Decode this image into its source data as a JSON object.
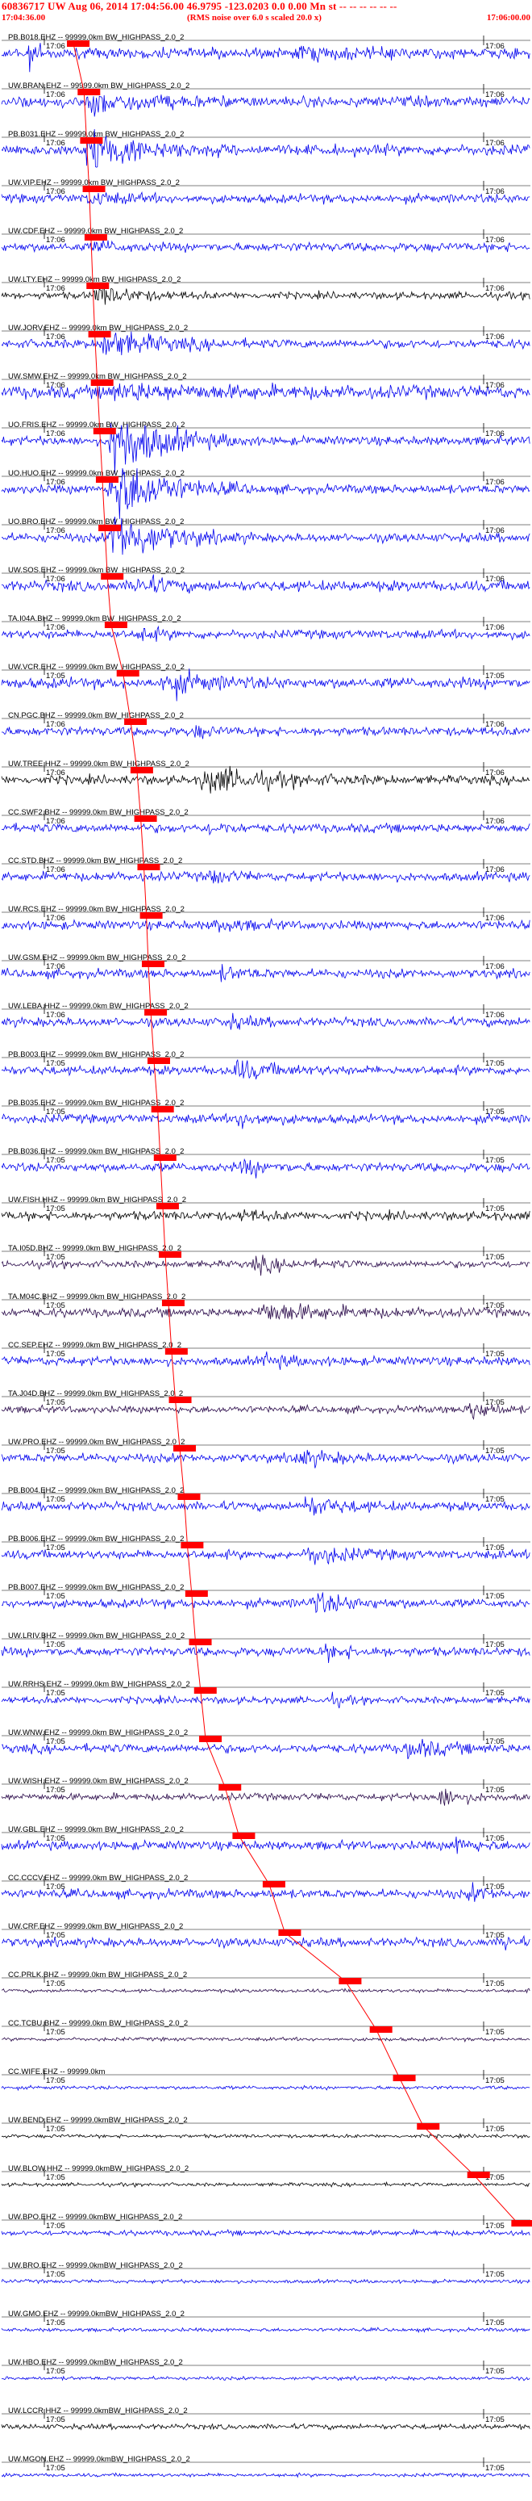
{
  "header": {
    "title": "60836717 UW Aug 06, 2014 17:04:56.00   46.9795 -123.0203  0.0 0.00 Mn st -- -- -- -- -- --",
    "start_time": "17:04:36.00",
    "noise_note": "(RMS noise over 6.0 s scaled 20.0 x)",
    "end_time": "17:06:00.00"
  },
  "colors": {
    "trace_blue": "#0000ee",
    "trace_black": "#000000",
    "trace_purple": "#2a0a4a",
    "marker": "#ff0000",
    "tick": "#000000"
  },
  "chart_data": {
    "type": "seismogram",
    "x_range": [
      "17:04:36.00",
      "17:06:00.00"
    ],
    "pick_times_s": [
      11.4,
      13.1,
      13.5,
      13.9,
      14.2,
      14.5,
      14.8,
      15.2,
      15.6,
      16.0,
      16.4,
      16.8,
      17.4,
      19.3,
      20.5,
      21.5,
      22.1,
      22.6,
      23.0,
      23.3,
      23.7,
      24.2,
      24.8,
      25.2,
      25.6,
      26.0,
      26.5,
      27.0,
      27.6,
      28.3,
      29.0,
      29.5,
      30.2,
      30.8,
      31.6,
      32.4,
      35.5,
      37.7,
      42.5,
      45.0,
      54.6,
      59.5,
      63.2,
      67.0,
      75.0,
      82.0
    ],
    "traces": [
      {
        "label": "PB.B018.EHZ -- 99999.0km BW_HIGHPASS_2.0_2",
        "tick_label": "17:06",
        "color": "blue",
        "amp": 6,
        "events": [
          [
            0.05,
            0.1,
            14
          ],
          [
            0.55,
            0.9,
            4
          ]
        ]
      },
      {
        "label": "UW.BRAN.EHZ -- 99999.0km BW_HIGHPASS_2.0_2",
        "tick_label": "17:06",
        "color": "blue",
        "amp": 6,
        "events": [
          [
            0.16,
            0.45,
            12
          ]
        ]
      },
      {
        "label": "PB.B031.EHZ -- 99999.0km BW_HIGHPASS_2.0_2",
        "tick_label": "17:06",
        "color": "blue",
        "amp": 6,
        "events": [
          [
            0.15,
            0.45,
            22
          ]
        ]
      },
      {
        "label": "UW.VIP.EHZ -- 99999.0km BW_HIGHPASS_2.0_2",
        "tick_label": "17:06",
        "color": "blue",
        "amp": 5,
        "events": [
          [
            0.16,
            0.35,
            6
          ]
        ]
      },
      {
        "label": "UW.CDF.EHZ -- 99999.0km BW_HIGHPASS_2.0_2",
        "tick_label": "17:06",
        "color": "blue",
        "amp": 5,
        "events": [
          [
            0.17,
            0.3,
            6
          ]
        ]
      },
      {
        "label": "UW.LTY.EHZ -- 99999.0km BW_HIGHPASS_2.0_2",
        "tick_label": "17:06",
        "color": "black",
        "amp": 4,
        "events": [
          [
            0.17,
            0.4,
            10
          ]
        ]
      },
      {
        "label": "UW.JORV.EHZ -- 99999.0km BW_HIGHPASS_2.0_2",
        "tick_label": "17:06",
        "color": "blue",
        "amp": 5,
        "events": [
          [
            0.18,
            0.5,
            14
          ]
        ]
      },
      {
        "label": "UW.SMW.EHZ -- 99999.0km BW_HIGHPASS_2.0_2",
        "tick_label": "17:06",
        "color": "blue",
        "amp": 7,
        "events": [
          [
            0.18,
            0.9,
            6
          ]
        ]
      },
      {
        "label": "UO.FRIS.EHZ -- 99999.0km BW_HIGHPASS_2.0_2",
        "tick_label": "17:06",
        "color": "blue",
        "amp": 5,
        "events": [
          [
            0.2,
            0.48,
            40
          ]
        ]
      },
      {
        "label": "UO.HUO.EHZ -- 99999.0km BW_HIGHPASS_2.0_2",
        "tick_label": "17:06",
        "color": "blue",
        "amp": 5,
        "events": [
          [
            0.2,
            0.48,
            40
          ]
        ]
      },
      {
        "label": "UO.BRO.EHZ -- 99999.0km BW_HIGHPASS_2.0_2",
        "tick_label": "17:06",
        "color": "blue",
        "amp": 5,
        "events": [
          [
            0.2,
            0.48,
            30
          ]
        ]
      },
      {
        "label": "UW.SOS.EHZ -- 99999.0km BW_HIGHPASS_2.0_2",
        "tick_label": "17:06",
        "color": "blue",
        "amp": 6,
        "events": [
          [
            0.25,
            0.4,
            10
          ]
        ]
      },
      {
        "label": "TA.I04A.BHZ -- 99999.0km BW_HIGHPASS_2.0_2",
        "tick_label": "17:06",
        "color": "blue",
        "amp": 5,
        "events": [
          [
            0.26,
            0.35,
            8
          ]
        ]
      },
      {
        "label": "UW.VCR.EHZ -- 99999.0km BW_HIGHPASS_2.0_2",
        "tick_label": "17:05",
        "color": "blue",
        "amp": 6,
        "events": [
          [
            0.3,
            0.55,
            12
          ]
        ]
      },
      {
        "label": "CN.PGC.BHZ -- 99999.0km BW_HIGHPASS_2.0_2",
        "tick_label": "17:06",
        "color": "blue",
        "amp": 5,
        "events": [
          [
            0.36,
            0.45,
            6
          ]
        ]
      },
      {
        "label": "UW.TREE.HHZ -- 99999.0km BW_HIGHPASS_2.0_2",
        "tick_label": "17:06",
        "color": "black",
        "amp": 5,
        "events": [
          [
            0.37,
            0.75,
            14
          ]
        ]
      },
      {
        "label": "CC.SWF2.BHZ -- 99999.0km BW_HIGHPASS_2.0_2",
        "tick_label": "17:06",
        "color": "blue",
        "amp": 5,
        "events": [
          [
            0.39,
            0.5,
            6
          ]
        ]
      },
      {
        "label": "CC.STD.BHZ -- 99999.0km BW_HIGHPASS_2.0_2",
        "tick_label": "17:06",
        "color": "blue",
        "amp": 5,
        "events": [
          [
            0.39,
            0.5,
            8
          ]
        ]
      },
      {
        "label": "UW.RCS.EHZ -- 99999.0km BW_HIGHPASS_2.0_2",
        "tick_label": "17:06",
        "color": "blue",
        "amp": 5,
        "events": [
          [
            0.4,
            0.55,
            6
          ]
        ]
      },
      {
        "label": "UW.GSM.EHZ -- 99999.0km BW_HIGHPASS_2.0_2",
        "tick_label": "17:06",
        "color": "blue",
        "amp": 5,
        "events": [
          [
            0.41,
            0.55,
            6
          ]
        ]
      },
      {
        "label": "UW.LEBA.HHZ -- 99999.0km BW_HIGHPASS_2.0_2",
        "tick_label": "17:06",
        "color": "blue",
        "amp": 5,
        "events": [
          [
            0.42,
            0.55,
            6
          ]
        ]
      },
      {
        "label": "PB.B003.EHZ -- 99999.0km BW_HIGHPASS_2.0_2",
        "tick_label": "17:05",
        "color": "blue",
        "amp": 5,
        "events": [
          [
            0.43,
            0.65,
            10
          ]
        ]
      },
      {
        "label": "PB.B035.EHZ -- 99999.0km BW_HIGHPASS_2.0_2",
        "tick_label": "17:05",
        "color": "blue",
        "amp": 5,
        "events": [
          [
            0.44,
            0.6,
            8
          ]
        ]
      },
      {
        "label": "PB.B036.EHZ -- 99999.0km BW_HIGHPASS_2.0_2",
        "tick_label": "17:05",
        "color": "blue",
        "amp": 5,
        "events": [
          [
            0.45,
            0.6,
            8
          ]
        ]
      },
      {
        "label": "UW.FISH.HHZ -- 99999.0km BW_HIGHPASS_2.0_2",
        "tick_label": "17:05",
        "color": "black",
        "amp": 5,
        "events": [
          [
            0.45,
            0.55,
            6
          ]
        ]
      },
      {
        "label": "TA.I05D.BHZ -- 99999.0km BW_HIGHPASS_2.0_2",
        "tick_label": "17:05",
        "color": "purple",
        "amp": 4,
        "events": [
          [
            0.47,
            0.7,
            7
          ]
        ]
      },
      {
        "label": "TA.M04C.BHZ -- 99999.0km BW_HIGHPASS_2.0_2",
        "tick_label": "17:05",
        "color": "purple",
        "amp": 5,
        "events": [
          [
            0.48,
            0.85,
            10
          ]
        ]
      },
      {
        "label": "CC.SEP.EHZ -- 99999.0km BW_HIGHPASS_2.0_2",
        "tick_label": "17:05",
        "color": "blue",
        "amp": 5,
        "events": [
          [
            0.49,
            0.65,
            6
          ]
        ]
      },
      {
        "label": "TA.J04D.BHZ -- 99999.0km BW_HIGHPASS_2.0_2",
        "tick_label": "17:05",
        "color": "purple",
        "amp": 4,
        "events": [
          [
            0.88,
            1.0,
            14
          ]
        ]
      },
      {
        "label": "UW.PRO.EHZ -- 99999.0km BW_HIGHPASS_2.0_2",
        "tick_label": "17:05",
        "color": "blue",
        "amp": 5,
        "events": [
          [
            0.55,
            0.75,
            8
          ]
        ]
      },
      {
        "label": "PB.B004.EHZ -- 99999.0km BW_HIGHPASS_2.0_2",
        "tick_label": "17:05",
        "color": "blue",
        "amp": 5,
        "events": [
          [
            0.56,
            0.8,
            10
          ]
        ]
      },
      {
        "label": "PB.B006.EHZ -- 99999.0km BW_HIGHPASS_2.0_2",
        "tick_label": "17:05",
        "color": "blue",
        "amp": 5,
        "events": [
          [
            0.57,
            0.8,
            10
          ]
        ]
      },
      {
        "label": "PB.B007.EHZ -- 99999.0km BW_HIGHPASS_2.0_2",
        "tick_label": "17:05",
        "color": "blue",
        "amp": 5,
        "events": [
          [
            0.58,
            0.8,
            10
          ]
        ]
      },
      {
        "label": "UW.LRIV.BHZ -- 99999.0km BW_HIGHPASS_2.0_2",
        "tick_label": "17:05",
        "color": "blue",
        "amp": 5,
        "events": [
          [
            0.6,
            0.8,
            6
          ]
        ]
      },
      {
        "label": "UW.RRHS.EHZ -- 99999.0km BW_HIGHPASS_2.0_2",
        "tick_label": "17:05",
        "color": "blue",
        "amp": 4,
        "events": [
          [
            0.62,
            0.7,
            5
          ]
        ]
      },
      {
        "label": "UW.WNW.EHZ -- 99999.0km BW_HIGHPASS_2.0_2",
        "tick_label": "17:05",
        "color": "blue",
        "amp": 5,
        "events": [
          [
            0.76,
            0.95,
            10
          ]
        ]
      },
      {
        "label": "UW.WISH.EHZ -- 99999.0km BW_HIGHPASS_2.0_2",
        "tick_label": "17:05",
        "color": "purple",
        "amp": 4,
        "events": [
          [
            0.82,
            0.95,
            12
          ]
        ]
      },
      {
        "label": "UW.GBL.EHZ -- 99999.0km BW_HIGHPASS_2.0_2",
        "tick_label": "17:05",
        "color": "blue",
        "amp": 5,
        "events": [
          [
            0.85,
            0.97,
            8
          ]
        ]
      },
      {
        "label": "CC.CCCV.EHZ -- 99999.0km BW_HIGHPASS_2.0_2",
        "tick_label": "17:05",
        "color": "blue",
        "amp": 5,
        "events": [
          [
            0.88,
            1.0,
            8
          ]
        ]
      },
      {
        "label": "UW.CRF.EHZ -- 99999.0km BW_HIGHPASS_2.0_2",
        "tick_label": "17:05",
        "color": "blue",
        "amp": 5,
        "events": [
          [
            0.95,
            1.0,
            10
          ]
        ]
      },
      {
        "label": "CC.PRLK.BHZ -- 99999.0km BW_HIGHPASS_2.0_2",
        "tick_label": "17:05",
        "color": "purple",
        "amp": 2,
        "events": []
      },
      {
        "label": "CC.TCBU.BHZ -- 99999.0km BW_HIGHPASS_2.0_2",
        "tick_label": "17:05",
        "color": "purple",
        "amp": 2,
        "events": []
      },
      {
        "label": "CC.WIFE.EHZ -- 99999.0km",
        "tick_label": "17:05",
        "color": "blue",
        "amp": 2,
        "events": []
      },
      {
        "label": "UW.BEND.EHZ -- 99999.0kmBW_HIGHPASS_2.0_2",
        "tick_label": "17:05",
        "color": "black",
        "amp": 2,
        "events": []
      },
      {
        "label": "UW.BLOW.HHZ -- 99999.0kmBW_HIGHPASS_2.0_2",
        "tick_label": "17:05",
        "color": "black",
        "amp": 2,
        "events": []
      },
      {
        "label": "UW.BPO.EHZ -- 99999.0kmBW_HIGHPASS_2.0_2",
        "tick_label": "17:05",
        "color": "blue",
        "amp": 3,
        "events": []
      },
      {
        "label": "UW.BRO.EHZ -- 99999.0kmBW_HIGHPASS_2.0_2",
        "tick_label": "17:05",
        "color": "blue",
        "amp": 2,
        "events": []
      },
      {
        "label": "UW.GMO.EHZ -- 99999.0kmBW_HIGHPASS_2.0_2",
        "tick_label": "17:05",
        "color": "blue",
        "amp": 2,
        "events": []
      },
      {
        "label": "UW.HBO.EHZ -- 99999.0kmBW_HIGHPASS_2.0_2",
        "tick_label": "17:05",
        "color": "blue",
        "amp": 2,
        "events": []
      },
      {
        "label": "UW.LCCR.HHZ -- 99999.0kmBW_HIGHPASS_2.0_2",
        "tick_label": "17:05",
        "color": "black",
        "amp": 3,
        "events": []
      },
      {
        "label": "UW.MGON.EHZ -- 99999.0kmBW_HIGHPASS_2.0_2",
        "tick_label": "17:05",
        "color": "blue",
        "amp": 2,
        "events": []
      }
    ]
  }
}
